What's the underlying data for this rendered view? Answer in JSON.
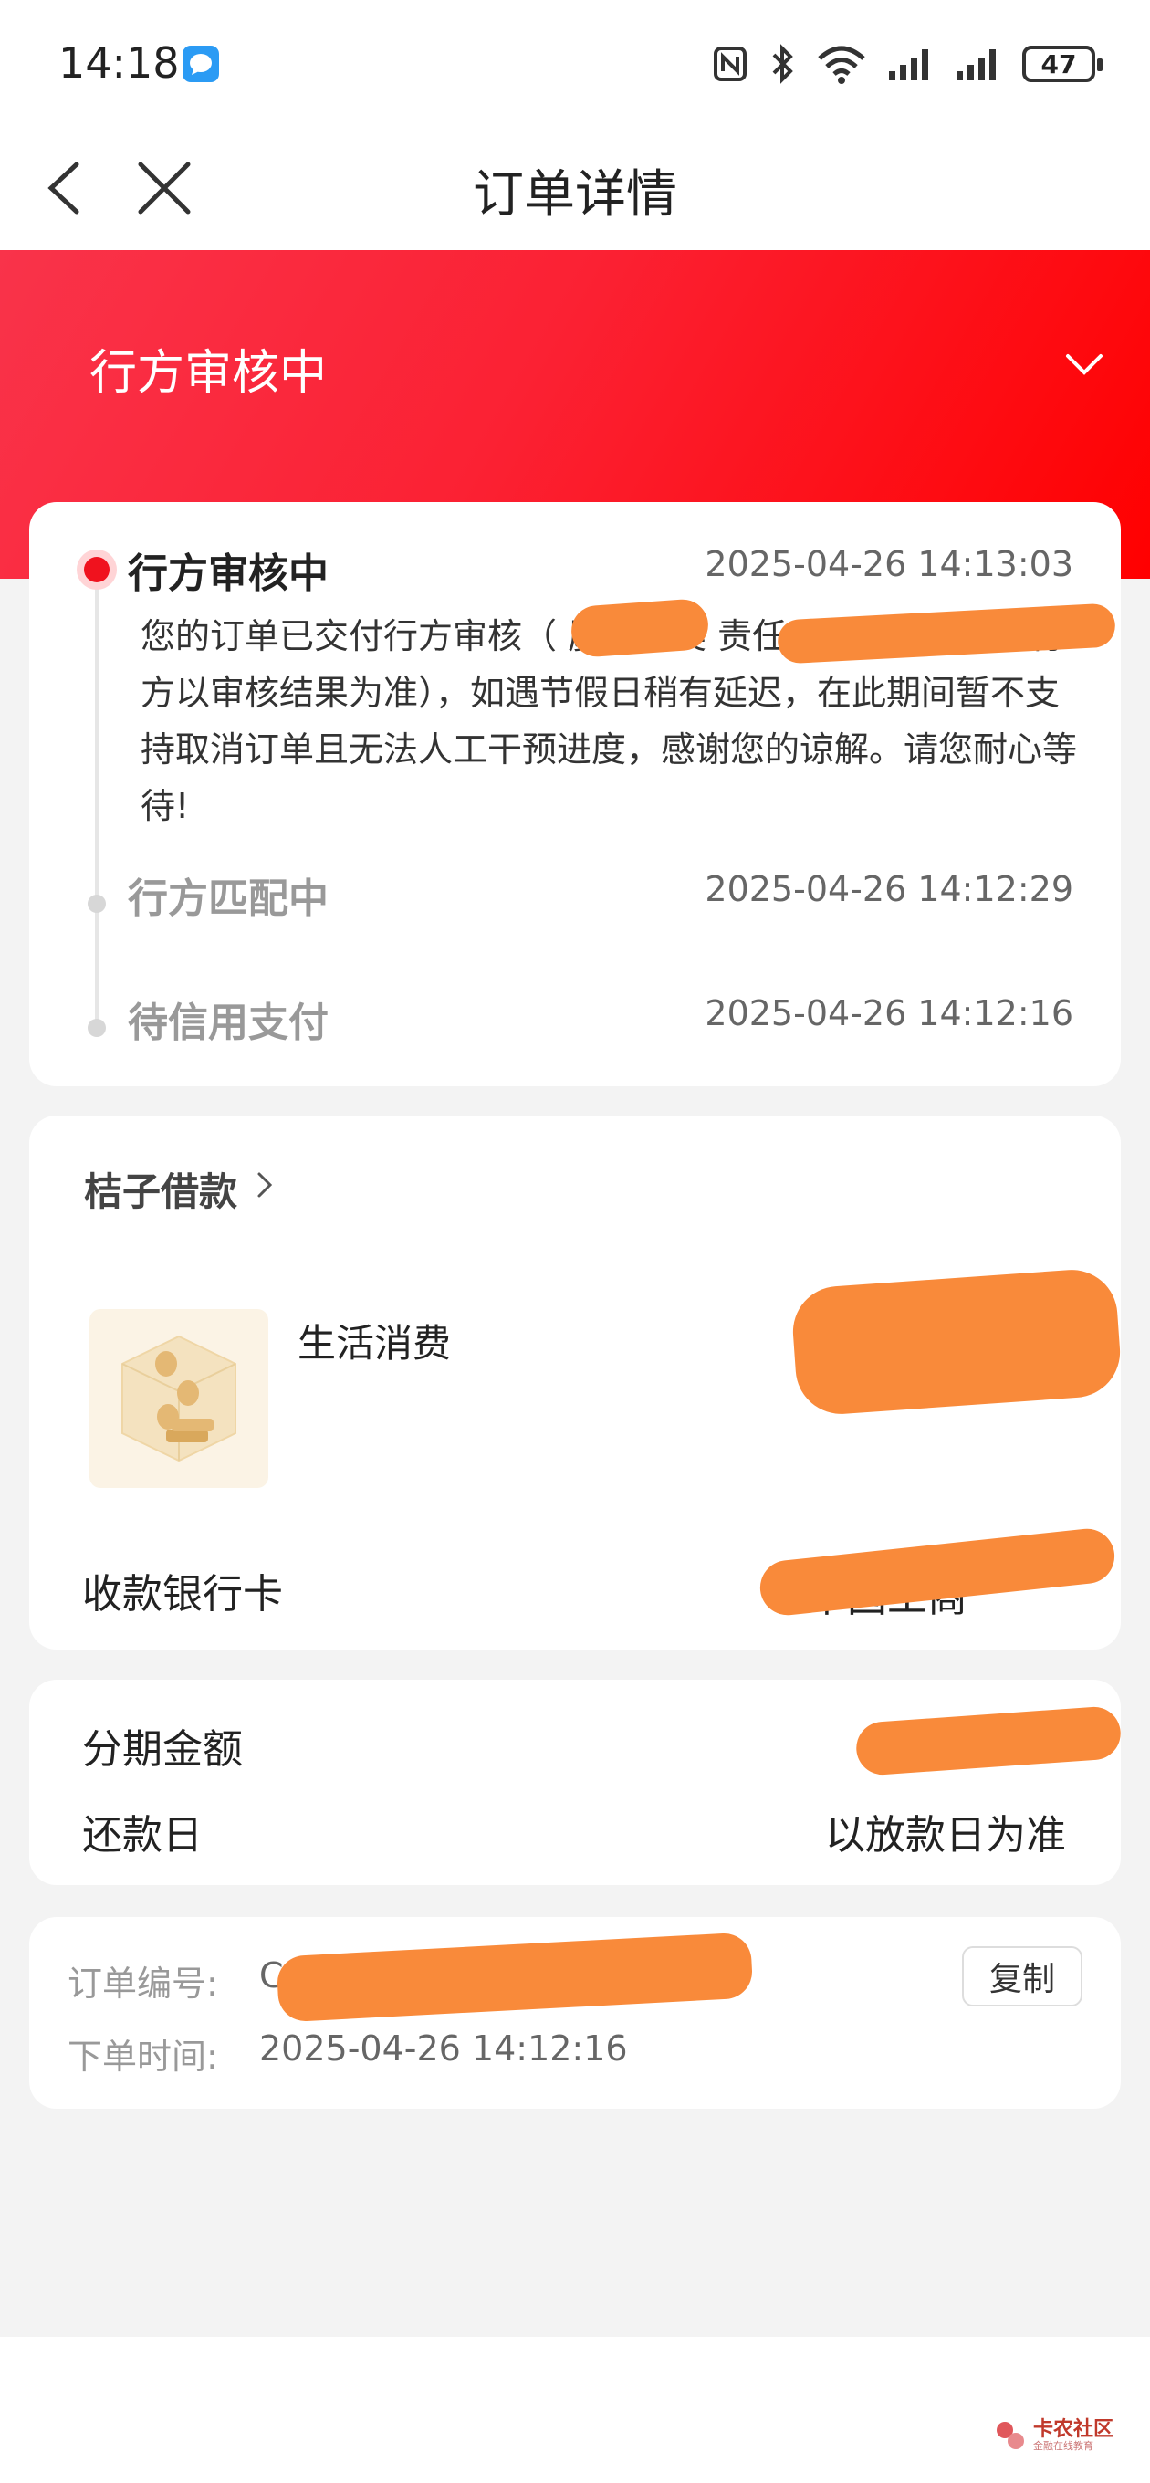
{
  "status_bar": {
    "time": "14:18",
    "battery": "47"
  },
  "nav": {
    "title": "订单详情"
  },
  "banner": {
    "title": "行方审核中"
  },
  "timeline": [
    {
      "title": "行方审核中",
      "time": "2025-04-26 14:13:03",
      "description": "您的订单已交付行方审核（ 厦门金美 责任公司，最终放款行方以审核结果为准），如遇节假日稍有延迟，在此期间暂不支持取消订单且无法人工干预进度，感谢您的谅解。请您耐心等待!"
    },
    {
      "title": "行方匹配中",
      "time": "2025-04-26 14:12:29"
    },
    {
      "title": "待信用支付",
      "time": "2025-04-26 14:12:16"
    }
  ],
  "product": {
    "shop_name": "桔子借款",
    "item_name": "生活消费",
    "bank_label": "收款银行卡",
    "bank_value": "中国工商"
  },
  "amount": {
    "installment_label": "分期金额",
    "installment_value": "¥",
    "repay_label": "还款日",
    "repay_value": "以放款日为准"
  },
  "order": {
    "number_label": "订单编号:",
    "number_value": "C",
    "time_label": "下单时间:",
    "time_value": "2025-04-26 14:12:16",
    "copy_label": "复制"
  },
  "watermark": {
    "name": "卡农社区",
    "sub": "金融在线教育"
  },
  "colors": {
    "accent_red": "#f0121e",
    "banner_start": "#f9334a",
    "banner_end": "#ff0000",
    "redaction": "#f98a3a"
  }
}
